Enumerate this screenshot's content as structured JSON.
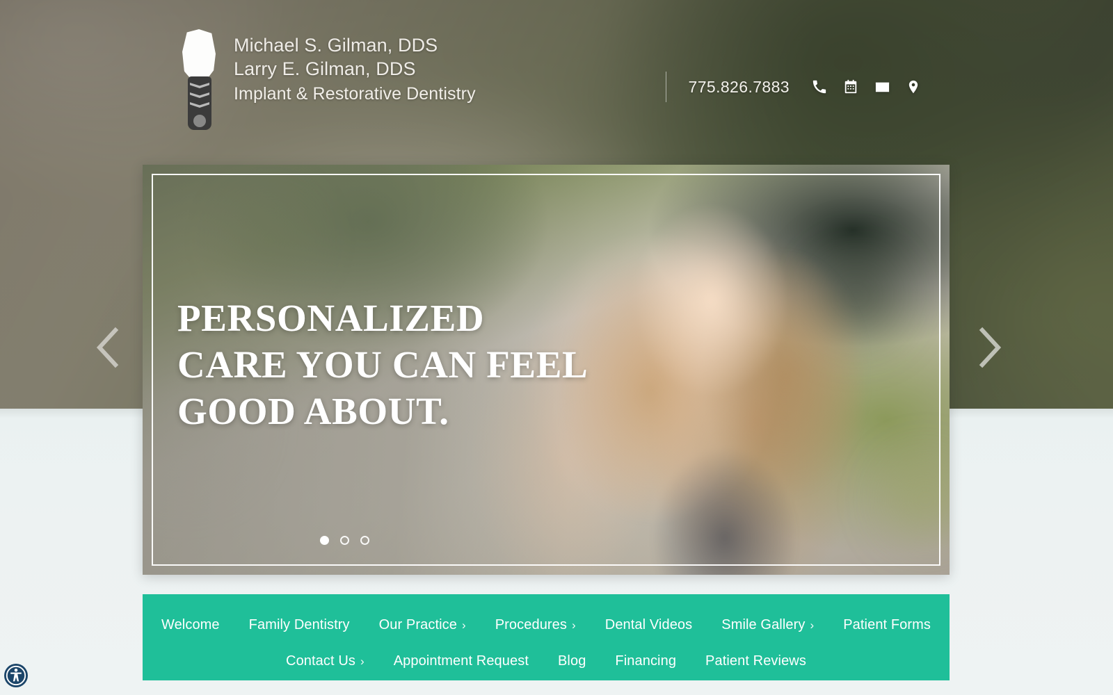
{
  "brand": {
    "logo_icon": "dental-implant-icon",
    "doctor_one": "Michael S. Gilman, DDS",
    "doctor_two": "Larry E. Gilman, DDS",
    "tagline": "Implant & Restorative Dentistry"
  },
  "contact": {
    "phone": "775.826.7883",
    "icons": [
      {
        "name": "phone-icon",
        "label": "Call"
      },
      {
        "name": "calendar-icon",
        "label": "Appointment"
      },
      {
        "name": "envelope-icon",
        "label": "Email"
      },
      {
        "name": "map-pin-icon",
        "label": "Location"
      }
    ]
  },
  "hero": {
    "headline_line1": "PERSONALIZED",
    "headline_line2": "CARE YOU CAN FEEL",
    "headline_line3": "GOOD ABOUT.",
    "prev_icon": "chevron-left-icon",
    "next_icon": "chevron-right-icon",
    "slides": [
      {
        "index": 1,
        "active": true
      },
      {
        "index": 2,
        "active": false
      },
      {
        "index": 3,
        "active": false
      }
    ]
  },
  "nav": {
    "row1": [
      {
        "label": "Welcome",
        "has_submenu": false,
        "caret": ""
      },
      {
        "label": "Family Dentistry",
        "has_submenu": false,
        "caret": ""
      },
      {
        "label": "Our Practice",
        "has_submenu": true,
        "caret": "›"
      },
      {
        "label": "Procedures",
        "has_submenu": true,
        "caret": "›"
      },
      {
        "label": "Dental Videos",
        "has_submenu": false,
        "caret": ""
      },
      {
        "label": "Smile Gallery",
        "has_submenu": true,
        "caret": "›"
      },
      {
        "label": "Patient Forms",
        "has_submenu": false,
        "caret": ""
      }
    ],
    "row2": [
      {
        "label": "Contact Us",
        "has_submenu": true,
        "caret": "›"
      },
      {
        "label": "Appointment Request",
        "has_submenu": false,
        "caret": ""
      },
      {
        "label": "Blog",
        "has_submenu": false,
        "caret": ""
      },
      {
        "label": "Financing",
        "has_submenu": false,
        "caret": ""
      },
      {
        "label": "Patient Reviews",
        "has_submenu": false,
        "caret": ""
      }
    ]
  },
  "accessibility": {
    "icon": "accessibility-person-icon",
    "color": "#1b4569"
  },
  "colors": {
    "nav_teal": "#1fbf99",
    "page_background": "#eef3f3",
    "brand_text": "#efece7",
    "accessibility_navy": "#1b4569"
  }
}
